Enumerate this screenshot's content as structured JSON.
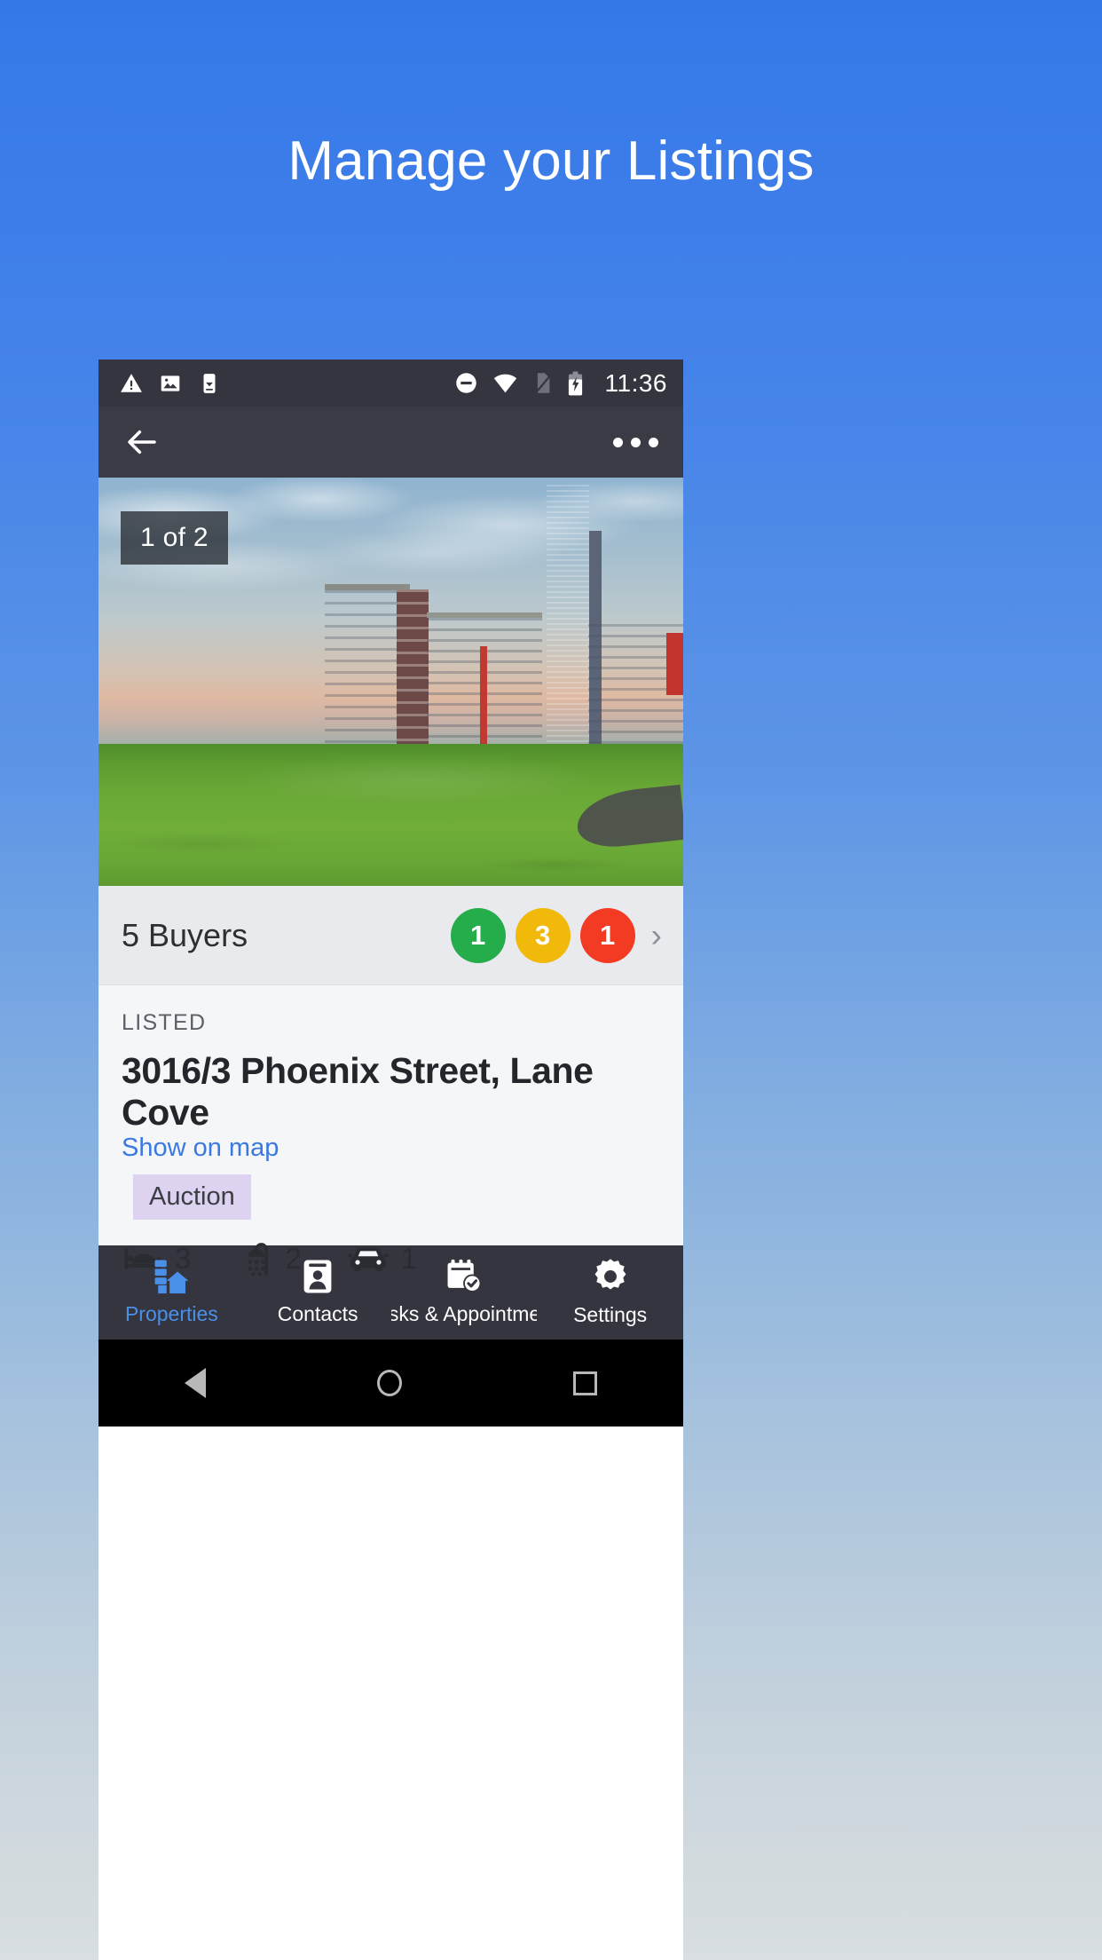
{
  "headline": "Manage your Listings",
  "statusbar": {
    "time": "11:36",
    "left_icons": [
      "warning-triangle-icon",
      "image-icon",
      "phone-download-icon"
    ],
    "right_icons": [
      "do-not-disturb-icon",
      "wifi-icon",
      "no-sim-icon",
      "battery-charging-icon"
    ]
  },
  "appbar": {
    "back_icon": "back-arrow-icon",
    "overflow_icon": "overflow-menu-icon"
  },
  "hero": {
    "photo_counter": "1 of 2",
    "alt": "park-lawn-with-apartment-buildings-photo"
  },
  "buyers": {
    "label": "5 Buyers",
    "badges": [
      {
        "value": "1",
        "color": "#25ac4b"
      },
      {
        "value": "3",
        "color": "#f1b90a"
      },
      {
        "value": "1",
        "color": "#f23b22"
      }
    ],
    "chevron": "›"
  },
  "listing": {
    "status": "LISTED",
    "address": "3016/3 Phoenix Street, Lane Cove",
    "map_link": "Show on map",
    "tag": "Auction",
    "tag_color": "#ddd2f0",
    "features": [
      {
        "icon": "bed-icon",
        "value": "3"
      },
      {
        "icon": "shower-icon",
        "value": "2"
      },
      {
        "icon": "car-icon",
        "value": "1"
      }
    ]
  },
  "bottom_nav": {
    "active_color": "#4a90e8",
    "items": [
      {
        "label": "Properties",
        "icon": "properties-icon",
        "active": true
      },
      {
        "label": "Contacts",
        "icon": "contacts-icon",
        "active": false
      },
      {
        "label": "Tasks & Appointme…",
        "icon": "tasks-calendar-icon",
        "active": false
      },
      {
        "label": "Settings",
        "icon": "gear-icon",
        "active": false
      }
    ]
  },
  "system_nav": {
    "back": "android-back-icon",
    "home": "android-home-icon",
    "recents": "android-recents-icon"
  },
  "theme": {
    "page_top": "#3478e8",
    "page_bottom": "#d8dee1",
    "appbar_bg": "#3a3b45",
    "statusbar_bg": "#34353f",
    "link_blue": "#3b78e0"
  }
}
